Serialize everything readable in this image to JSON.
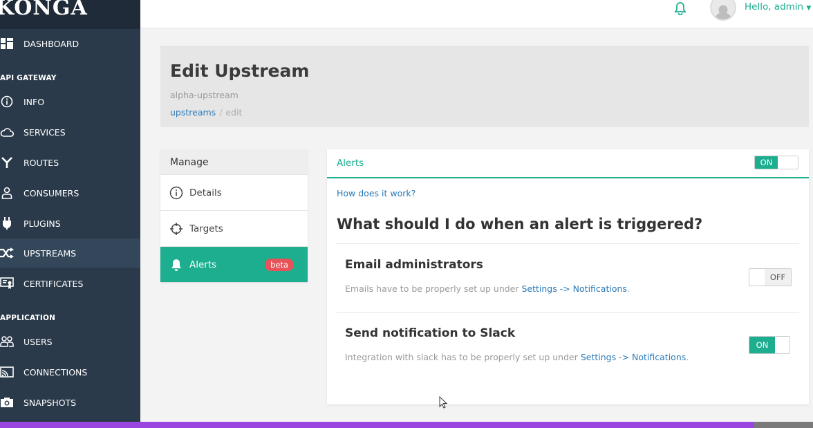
{
  "brand": {
    "logo": "KONGA"
  },
  "sidebar": {
    "dashboard": "DASHBOARD",
    "section_api": "API GATEWAY",
    "items_api": [
      {
        "label": "INFO",
        "icon": "info-icon"
      },
      {
        "label": "SERVICES",
        "icon": "cloud-icon"
      },
      {
        "label": "ROUTES",
        "icon": "routes-icon"
      },
      {
        "label": "CONSUMERS",
        "icon": "user-icon"
      },
      {
        "label": "PLUGINS",
        "icon": "plug-icon"
      },
      {
        "label": "UPSTREAMS",
        "icon": "shuffle-icon",
        "active": true
      },
      {
        "label": "CERTIFICATES",
        "icon": "certificate-icon"
      }
    ],
    "section_app": "APPLICATION",
    "items_app": [
      {
        "label": "USERS",
        "icon": "users-icon"
      },
      {
        "label": "CONNECTIONS",
        "icon": "cast-icon"
      },
      {
        "label": "SNAPSHOTS",
        "icon": "camera-icon"
      }
    ]
  },
  "topbar": {
    "greeting": "Hello, admin"
  },
  "header": {
    "title": "Edit Upstream",
    "subtitle": "alpha-upstream",
    "breadcrumb_link": "upstreams",
    "breadcrumb_sep": "/",
    "breadcrumb_current": "edit"
  },
  "manage": {
    "heading": "Manage",
    "items": [
      {
        "label": "Details",
        "icon": "info-icon"
      },
      {
        "label": "Targets",
        "icon": "crosshair-icon"
      },
      {
        "label": "Alerts",
        "icon": "bell-icon",
        "badge": "beta",
        "active": true
      }
    ]
  },
  "alerts": {
    "title": "Alerts",
    "master_toggle": "ON",
    "help_link": "How does it work?",
    "question": "What should I do when an alert is triggered?",
    "email": {
      "title": "Email administrators",
      "desc_prefix": "Emails have to be properly set up under ",
      "link": "Settings -> Notifications",
      "desc_suffix": ".",
      "toggle": "OFF"
    },
    "slack": {
      "title": "Send notification to Slack",
      "desc_prefix": "Integration with slack has to be properly set up under ",
      "link": "Settings -> Notifications",
      "desc_suffix": ".",
      "toggle": "ON"
    }
  },
  "colors": {
    "accent": "#1cae8f",
    "sidebar": "#2b3a4a",
    "link": "#2a7ab8",
    "badge": "#e8535a"
  }
}
